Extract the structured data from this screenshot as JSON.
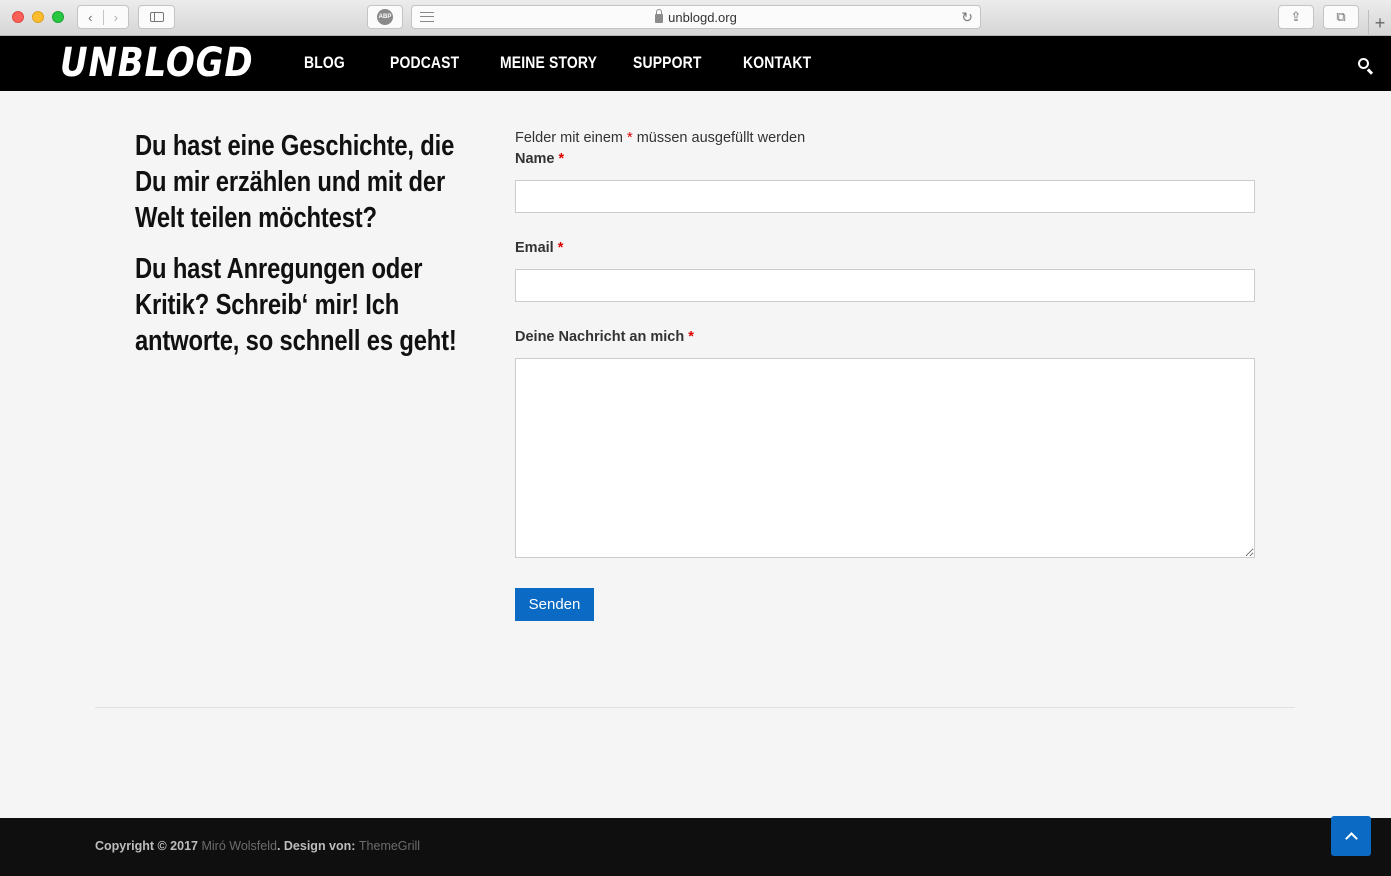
{
  "browser": {
    "back_glyph": "‹",
    "forward_glyph": "›",
    "abp_label": "ABP",
    "url": "unblogd.org",
    "reload_glyph": "↻",
    "share_glyph": "⇪",
    "tabs_glyph": "⧉",
    "new_tab_glyph": "+"
  },
  "header": {
    "logo": "UNBLOGD",
    "nav": [
      {
        "label": "BLOG"
      },
      {
        "label": "PODCAST"
      },
      {
        "label": "MEINE STORY"
      },
      {
        "label": "SUPPORT"
      },
      {
        "label": "KONTAKT"
      }
    ]
  },
  "intro": {
    "paragraph1": "Du hast eine Geschichte, die Du mir erzählen und mit der Welt teilen möchtest?",
    "paragraph2": "Du hast Anregungen oder Kritik? Schreib‘ mir! Ich antworte, so schnell es geht!"
  },
  "form": {
    "required_note_before": "Felder mit einem ",
    "required_mark": "*",
    "required_note_after": " müssen ausgefüllt werden",
    "name_label": "Name",
    "name_value": "",
    "email_label": "Email",
    "email_value": "",
    "message_label": "Deine Nachricht an mich",
    "message_value": "",
    "submit_label": "Senden"
  },
  "footer": {
    "copyright_prefix": "Copyright © 2017 ",
    "author": "Miró Wolsfeld",
    "design_prefix": ". Design von: ",
    "designer": "ThemeGrill"
  },
  "colors": {
    "accent": "#0a6ac4",
    "header_bg": "#000000",
    "page_bg": "#f5f5f5",
    "required": "#dd0000"
  },
  "icons": [
    "search-icon",
    "chevron-up-icon",
    "lock-icon",
    "reload-icon",
    "share-icon",
    "tabs-icon",
    "sidebar-icon"
  ]
}
